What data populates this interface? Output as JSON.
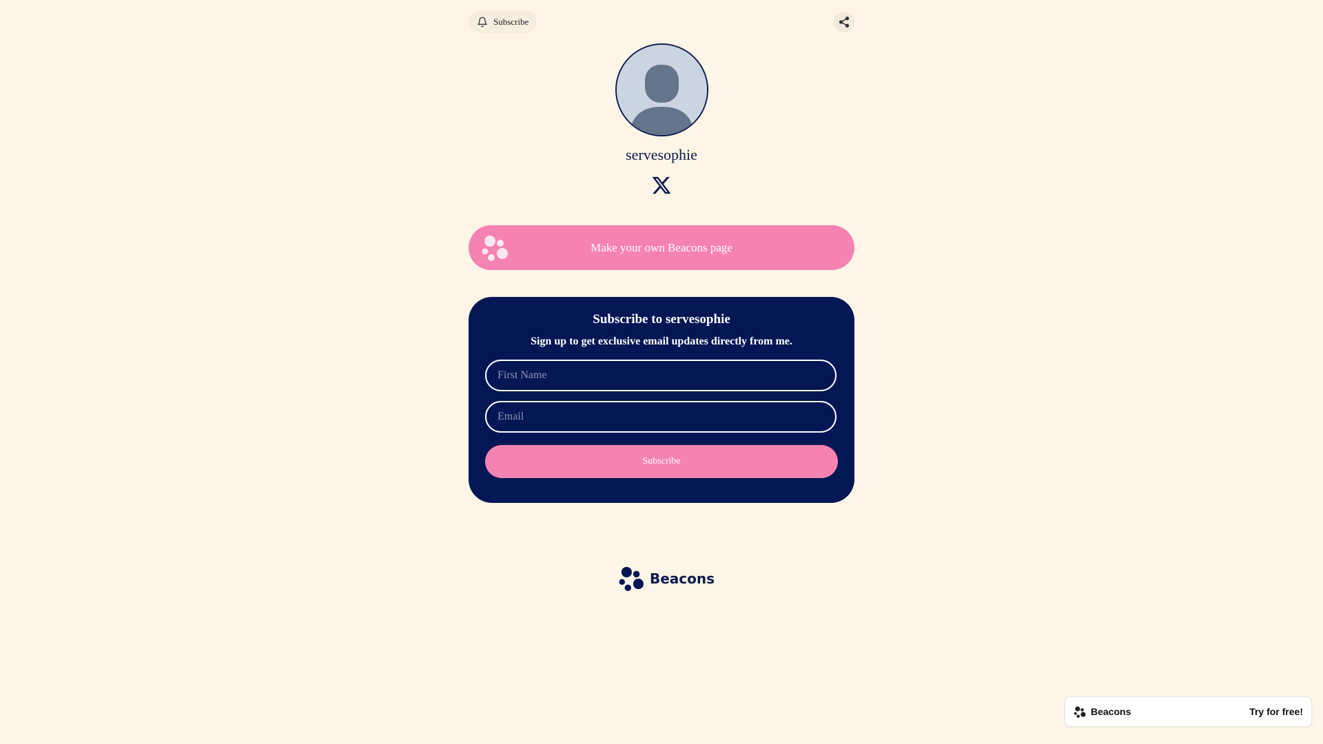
{
  "header": {
    "subscribe_label": "Subscribe"
  },
  "profile": {
    "username": "servesophie",
    "social_icons": [
      "x-icon"
    ]
  },
  "cta": {
    "label": "Make your own Beacons page"
  },
  "subscribe_card": {
    "title": "Subscribe to servesophie",
    "subtitle": "Sign up to get exclusive email updates directly from me.",
    "first_name_placeholder": "First Name",
    "email_placeholder": "Email",
    "button_label": "Subscribe"
  },
  "footer": {
    "brand": "Beacons"
  },
  "toast": {
    "brand": "Beacons",
    "cta_label": "Try for free!"
  },
  "colors": {
    "background": "#fdf5e8",
    "navy": "#031754",
    "pink": "#f583b1"
  }
}
